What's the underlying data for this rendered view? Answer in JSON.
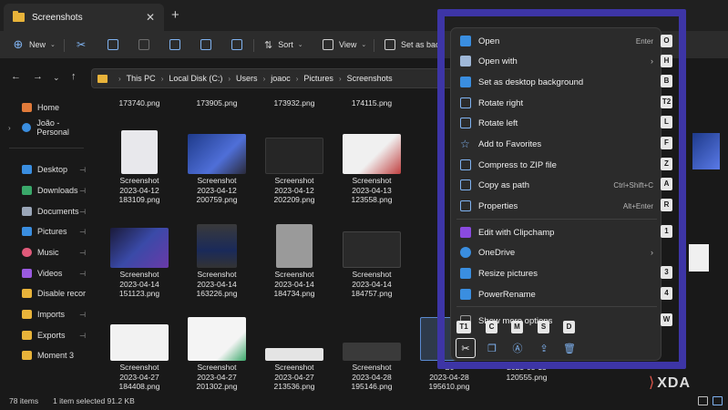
{
  "window": {
    "tab_title": "Screenshots",
    "tab_close": "✕",
    "tab_add": "+"
  },
  "toolbar": {
    "new": "New",
    "sort": "Sort",
    "view": "View",
    "set_as_background": "Set as bac"
  },
  "address": {
    "crumbs": [
      "This PC",
      "Local Disk (C:)",
      "Users",
      "joaoc",
      "Pictures",
      "Screenshots"
    ]
  },
  "sidebar": {
    "items": [
      {
        "label": "Home",
        "icon": "home-icon",
        "color": "#e07a3a"
      },
      {
        "label": "João - Personal",
        "icon": "onedrive-icon",
        "color": "#3a8ee0"
      },
      {
        "label": "Desktop",
        "icon": "desktop-icon",
        "color": "#3a8ee0"
      },
      {
        "label": "Downloads",
        "icon": "download-icon",
        "color": "#3aa86a"
      },
      {
        "label": "Documents",
        "icon": "document-icon",
        "color": "#9aa6b8"
      },
      {
        "label": "Pictures",
        "icon": "pictures-icon",
        "color": "#3a8ee0"
      },
      {
        "label": "Music",
        "icon": "music-icon",
        "color": "#e05a7a"
      },
      {
        "label": "Videos",
        "icon": "videos-icon",
        "color": "#9a5ae0"
      },
      {
        "label": "Disable recor",
        "icon": "folder-icon",
        "color": "#e8b33a"
      },
      {
        "label": "Imports",
        "icon": "folder-icon",
        "color": "#e8b33a"
      },
      {
        "label": "Exports",
        "icon": "folder-icon",
        "color": "#e8b33a"
      },
      {
        "label": "Moment 3",
        "icon": "folder-icon",
        "color": "#e8b33a"
      }
    ],
    "pin": "📌"
  },
  "files": {
    "top_labels": [
      "173740.png",
      "173905.png",
      "173932.png",
      "174115.png"
    ],
    "rows": [
      [
        {
          "l1": "Screenshot",
          "l2": "2023-04-12",
          "l3": "183109.png"
        },
        {
          "l1": "Screenshot",
          "l2": "2023-04-12",
          "l3": "200759.png"
        },
        {
          "l1": "Screenshot",
          "l2": "2023-04-12",
          "l3": "202209.png"
        },
        {
          "l1": "Screenshot",
          "l2": "2023-04-13",
          "l3": "123558.png"
        }
      ],
      [
        {
          "l1": "Screenshot",
          "l2": "2023-04-14",
          "l3": "151123.png"
        },
        {
          "l1": "Screenshot",
          "l2": "2023-04-14",
          "l3": "163226.png"
        },
        {
          "l1": "Screenshot",
          "l2": "2023-04-14",
          "l3": "184734.png"
        },
        {
          "l1": "Screenshot",
          "l2": "2023-04-14",
          "l3": "184757.png"
        }
      ],
      [
        {
          "l1": "Screenshot",
          "l2": "2023-04-27",
          "l3": "184408.png"
        },
        {
          "l1": "Screenshot",
          "l2": "2023-04-27",
          "l3": "201302.png"
        },
        {
          "l1": "Screenshot",
          "l2": "2023-04-27",
          "l3": "213536.png"
        },
        {
          "l1": "Screenshot",
          "l2": "2023-04-28",
          "l3": "195146.png"
        },
        {
          "l1": "Sc",
          "l2": "2023-04-28",
          "l3": "195610.png"
        },
        {
          "l1": "",
          "l2": "2023-05-15",
          "l3": "120555.png"
        }
      ]
    ]
  },
  "context_menu": {
    "items": [
      {
        "label": "Open",
        "shortcut": "Enter",
        "key": "O",
        "icon": "open-icon",
        "color": "#3a8ee0"
      },
      {
        "label": "Open with",
        "arrow": "›",
        "key": "H",
        "icon": "open-with-icon",
        "color": "#9fb8d8"
      },
      {
        "label": "Set as desktop background",
        "key": "B",
        "icon": "desktop-background-icon",
        "color": "#3a8ee0"
      },
      {
        "label": "Rotate right",
        "key": "T2",
        "icon": "rotate-right-icon",
        "color": "#7fb2f0"
      },
      {
        "label": "Rotate left",
        "key": "L",
        "icon": "rotate-left-icon",
        "color": "#7fb2f0"
      },
      {
        "label": "Add to Favorites",
        "key": "F",
        "icon": "star-icon",
        "color": "#7fb2f0"
      },
      {
        "label": "Compress to ZIP file",
        "key": "Z",
        "icon": "zip-icon",
        "color": "#7fb2f0"
      },
      {
        "label": "Copy as path",
        "shortcut": "Ctrl+Shift+C",
        "key": "A",
        "icon": "copy-path-icon",
        "color": "#7fb2f0"
      },
      {
        "label": "Properties",
        "shortcut": "Alt+Enter",
        "key": "R",
        "icon": "properties-icon",
        "color": "#7fb2f0"
      },
      {
        "label": "Edit with Clipchamp",
        "key": "1",
        "icon": "clipchamp-icon",
        "color": "#8a4ae0"
      },
      {
        "label": "OneDrive",
        "arrow": "›",
        "icon": "onedrive-icon",
        "color": "#3a8ee0"
      },
      {
        "label": "Resize pictures",
        "key": "3",
        "icon": "resize-icon",
        "color": "#3a8ee0"
      },
      {
        "label": "PowerRename",
        "key": "4",
        "icon": "powerrename-icon",
        "color": "#3a8ee0"
      },
      {
        "label": "Show more options",
        "key": "W",
        "icon": "more-options-icon",
        "color": "#9a9a9a"
      }
    ],
    "bottom_keys": [
      "T1",
      "C",
      "M",
      "S",
      "D"
    ],
    "bottom_icons": [
      "cut-icon",
      "copy-icon",
      "rename-icon",
      "share-icon",
      "delete-icon"
    ]
  },
  "status": {
    "count": "78 items",
    "selected": "1 item selected  91.2 KB"
  },
  "watermark": {
    "brand": "XDA"
  }
}
